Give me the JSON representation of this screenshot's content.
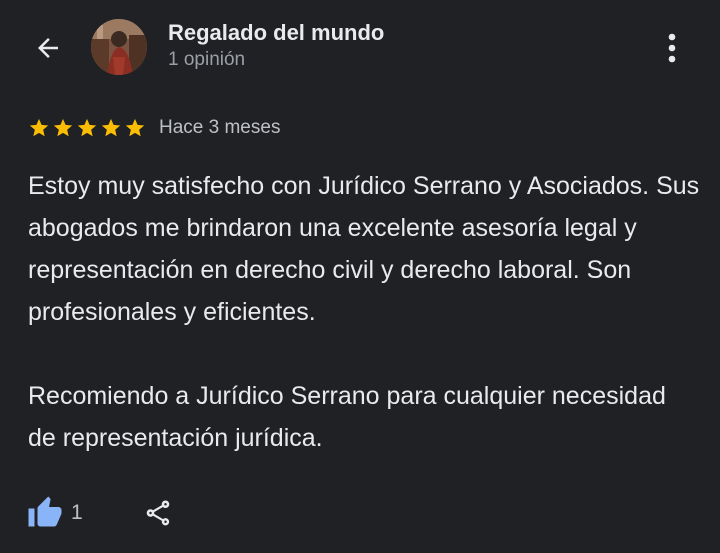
{
  "header": {
    "back_icon": "arrow-back-icon",
    "user_name": "Regalado del mundo",
    "user_reviews": "1 opinión",
    "more_icon": "more-vert-icon"
  },
  "review": {
    "rating": 5,
    "rating_max": 5,
    "star_color": "#fbbc04",
    "date": "Hace 3 meses",
    "paragraphs": [
      "Estoy muy satisfecho con Jurídico Serrano y Asociados. Sus abogados me brindaron una excelente asesoría legal y representación en derecho civil y derecho laboral. Son profesionales y eficientes.",
      "Recomiendo a Jurídico Serrano para cualquier necesidad de representación jurídica."
    ]
  },
  "actions": {
    "like_count": "1",
    "like_icon": "thumb-up-icon",
    "like_color": "#8ab4f8",
    "share_icon": "share-icon"
  },
  "colors": {
    "background": "#202124",
    "primary_text": "#e8eaed",
    "secondary_text": "#9aa0a6"
  }
}
